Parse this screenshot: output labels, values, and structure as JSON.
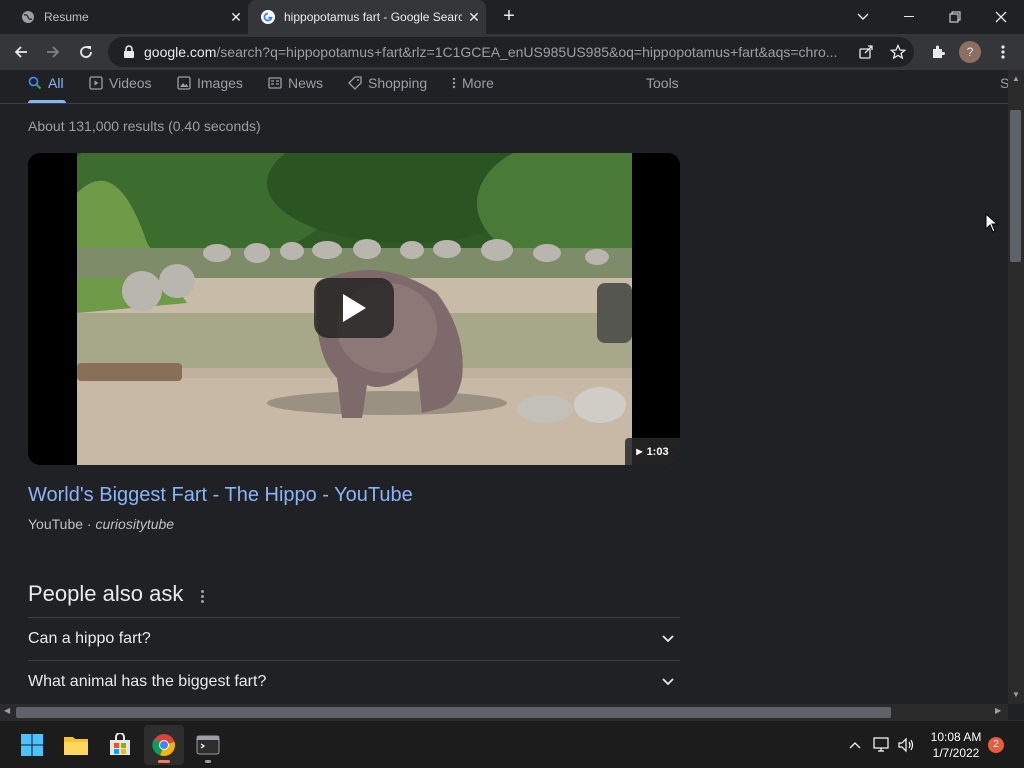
{
  "browser": {
    "tabs": [
      {
        "title": "Resume",
        "close": "✕"
      },
      {
        "title": "hippopotamus fart - Google Search",
        "close": "✕"
      }
    ],
    "new_tab": "+",
    "url_host": "google.com",
    "url_rest": "/search?q=hippopotamus+fart&rlz=1C1GCEA_enUS985US985&oq=hippopotamus+fart&aqs=chro...",
    "profile_initial": "?"
  },
  "search": {
    "tabs": [
      {
        "label": "All"
      },
      {
        "label": "Videos"
      },
      {
        "label": "Images"
      },
      {
        "label": "News"
      },
      {
        "label": "Shopping"
      },
      {
        "label": "More"
      }
    ],
    "tools": "Tools",
    "safesearch_partial": "S",
    "results_count": "About 131,000 results (0.40 seconds)"
  },
  "video_result": {
    "duration": "1:03",
    "title": "World's Biggest Fart - The Hippo - YouTube",
    "source": "YouTube",
    "separator": " · ",
    "channel": "curiositytube"
  },
  "people_also_ask": {
    "heading": "People also ask",
    "questions": [
      "Can a hippo fart?",
      "What animal has the biggest fart?"
    ]
  },
  "taskbar": {
    "time": "10:08 AM",
    "date": "1/7/2022",
    "notification_count": "2"
  },
  "colors": {
    "link": "#8ab4f8",
    "background": "#202124",
    "toolbar": "#35363a"
  }
}
